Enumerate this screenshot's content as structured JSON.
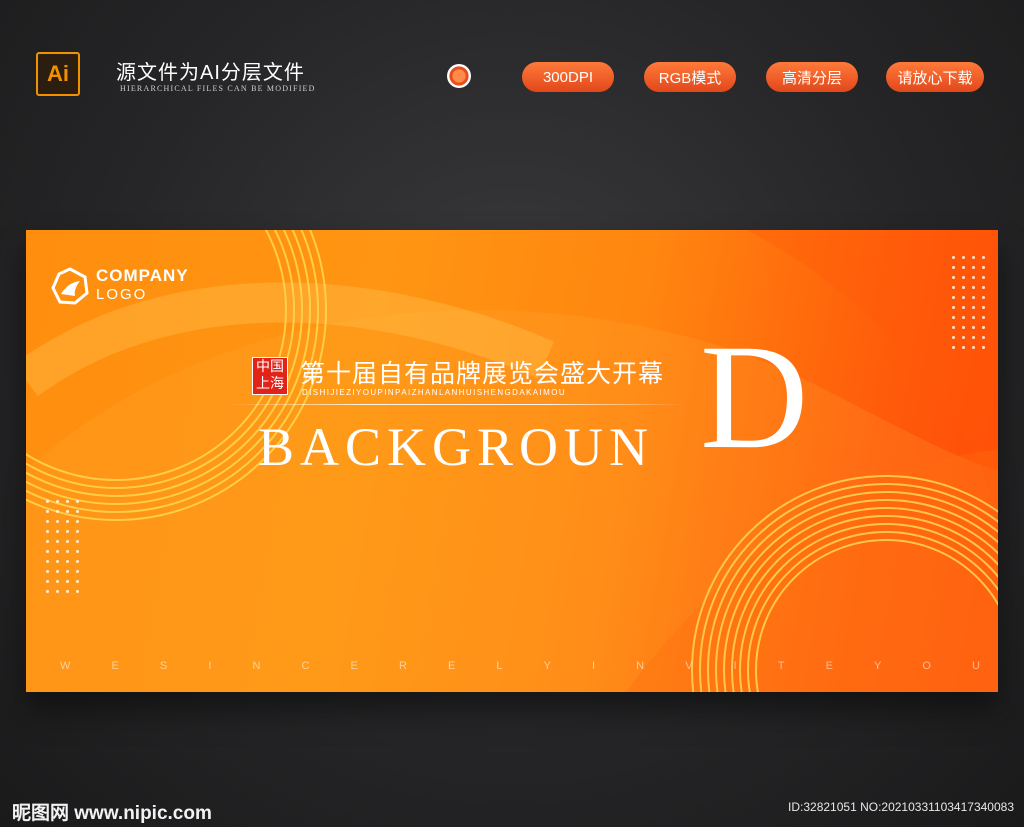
{
  "header": {
    "app_icon_label": "Ai",
    "title": "源文件为AI分层文件",
    "subtitle": "HIERARCHICAL FILES CAN BE MODIFIED",
    "badges": [
      "300DPI",
      "RGB模式",
      "高清分层",
      "请放心下载"
    ]
  },
  "banner": {
    "logo_line1": "COMPANY",
    "logo_line2": "LOGO",
    "seal_text": "中国上海",
    "cn_title": "第十届自有品牌展览会盛大开幕",
    "pinyin": "DISHIJIEZIYOUPINPAIZHANLANHUISHENGDAKAIMOU",
    "headline": "BACKGROUN",
    "headline_big_letter": "D",
    "invite_letters": [
      "W",
      "E",
      "S",
      "I",
      "N",
      "C",
      "E",
      "R",
      "E",
      "L",
      "Y",
      "I",
      "N",
      "V",
      "I",
      "T",
      "E",
      "Y",
      "O",
      "U"
    ]
  },
  "footer": {
    "watermark": "昵图网 www.nipic.com",
    "id_text": "ID:32821051 NO:20210331103417340083"
  },
  "colors": {
    "accent": "#ff8e0e",
    "accent_deep": "#ff4a08",
    "pill_top": "#ff7a3a",
    "seal_red": "#e2231a",
    "app_icon": "#f29100"
  }
}
